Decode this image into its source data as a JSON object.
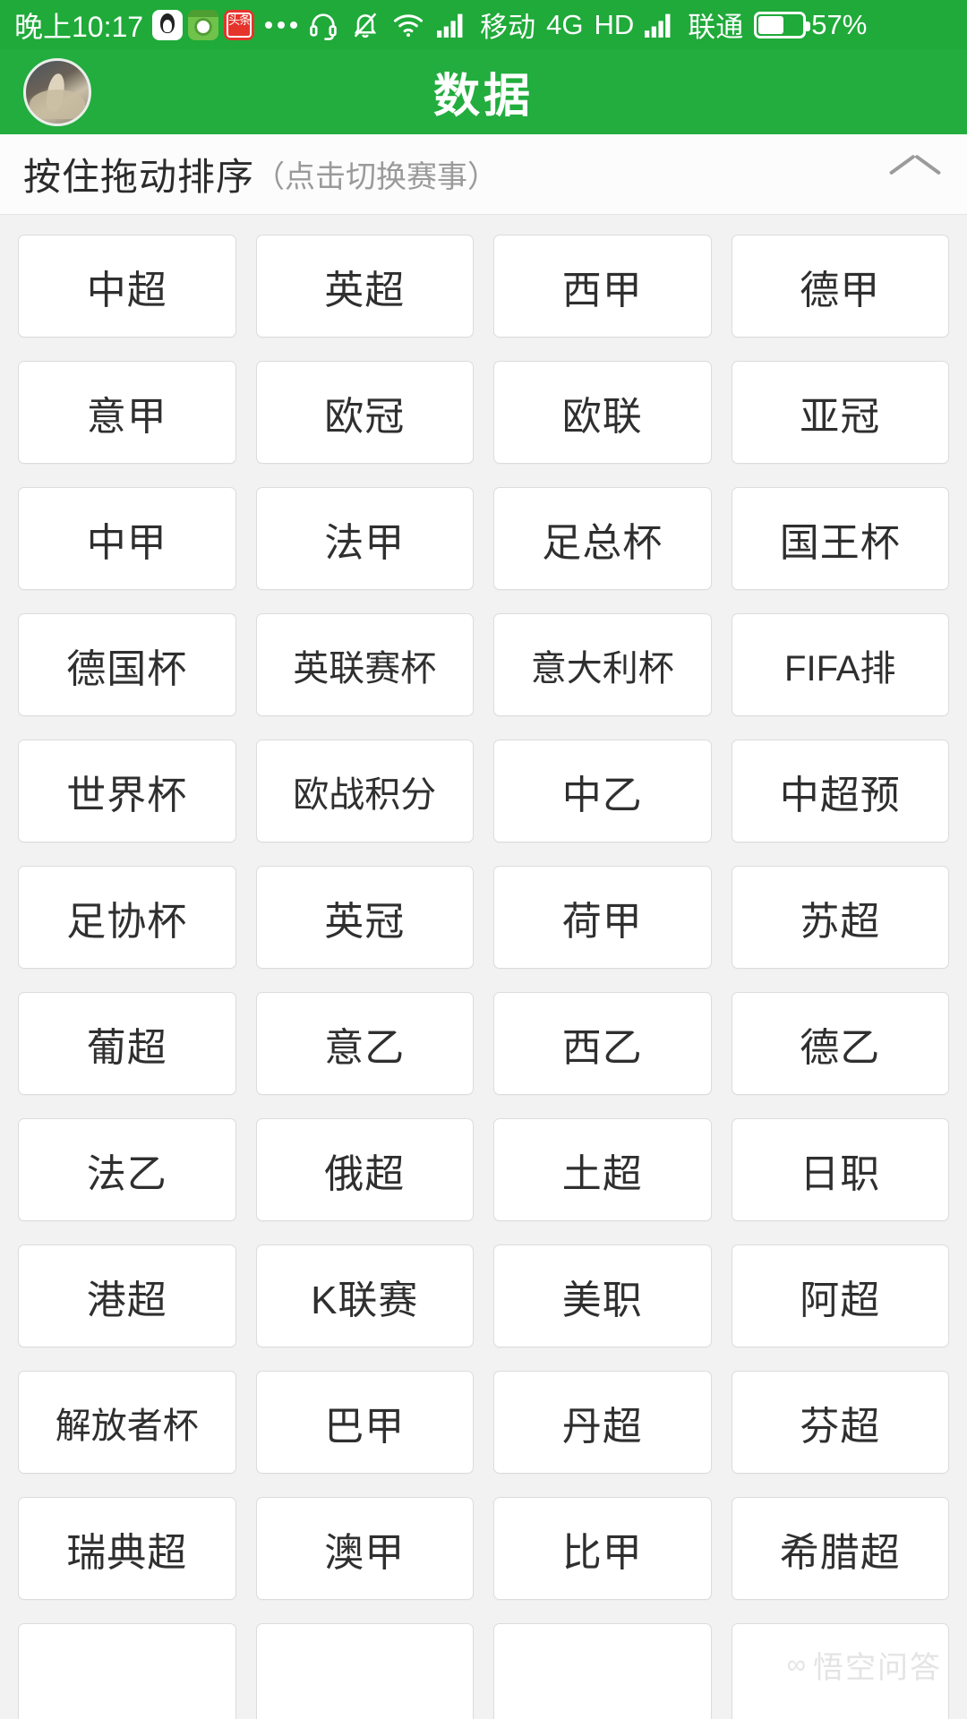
{
  "statusbar": {
    "time": "晚上10:17",
    "app_icons": [
      "qq-icon",
      "football-app-icon",
      "toutiao-icon"
    ],
    "overflow": "...",
    "headset_icon": "headset-icon",
    "mute_icon": "bell-muted-icon",
    "wifi_icon": "wifi-icon",
    "signal_icon_1": "signal-bars-icon",
    "carrier_1": "移动",
    "network": "4G",
    "volte": "HD",
    "signal_icon_2": "signal-bars-icon",
    "carrier_2": "联通",
    "battery_icon": "battery-icon",
    "battery_level": "57%",
    "battery_fill_pct": 57
  },
  "appbar": {
    "avatar": "user-avatar",
    "title": "数据"
  },
  "section": {
    "title_main": "按住拖动排序",
    "title_sub": "（点击切换赛事）",
    "collapse_icon": "chevron-up-icon"
  },
  "grid": {
    "columns": 4,
    "tiles": [
      "中超",
      "英超",
      "西甲",
      "德甲",
      "意甲",
      "欧冠",
      "欧联",
      "亚冠",
      "中甲",
      "法甲",
      "足总杯",
      "国王杯",
      "德国杯",
      "英联赛杯",
      "意大利杯",
      "FIFA排",
      "世界杯",
      "欧战积分",
      "中乙",
      "中超预",
      "足协杯",
      "英冠",
      "荷甲",
      "苏超",
      "葡超",
      "意乙",
      "西乙",
      "德乙",
      "法乙",
      "俄超",
      "土超",
      "日职",
      "港超",
      "K联赛",
      "美职",
      "阿超",
      "解放者杯",
      "巴甲",
      "丹超",
      "芬超",
      "瑞典超",
      "澳甲",
      "比甲",
      "希腊超",
      "",
      "",
      "",
      ""
    ]
  },
  "watermark": {
    "logo": "∞",
    "text": "悟空问答"
  },
  "colors": {
    "status_green": "#1faa39",
    "appbar_green": "#22ad3e",
    "page_bg": "#f2f2f2",
    "tile_bg": "#ffffff",
    "tile_border": "#dcdcdc",
    "text_dark": "#2f2f2f",
    "text_muted": "#9a9a9a"
  }
}
